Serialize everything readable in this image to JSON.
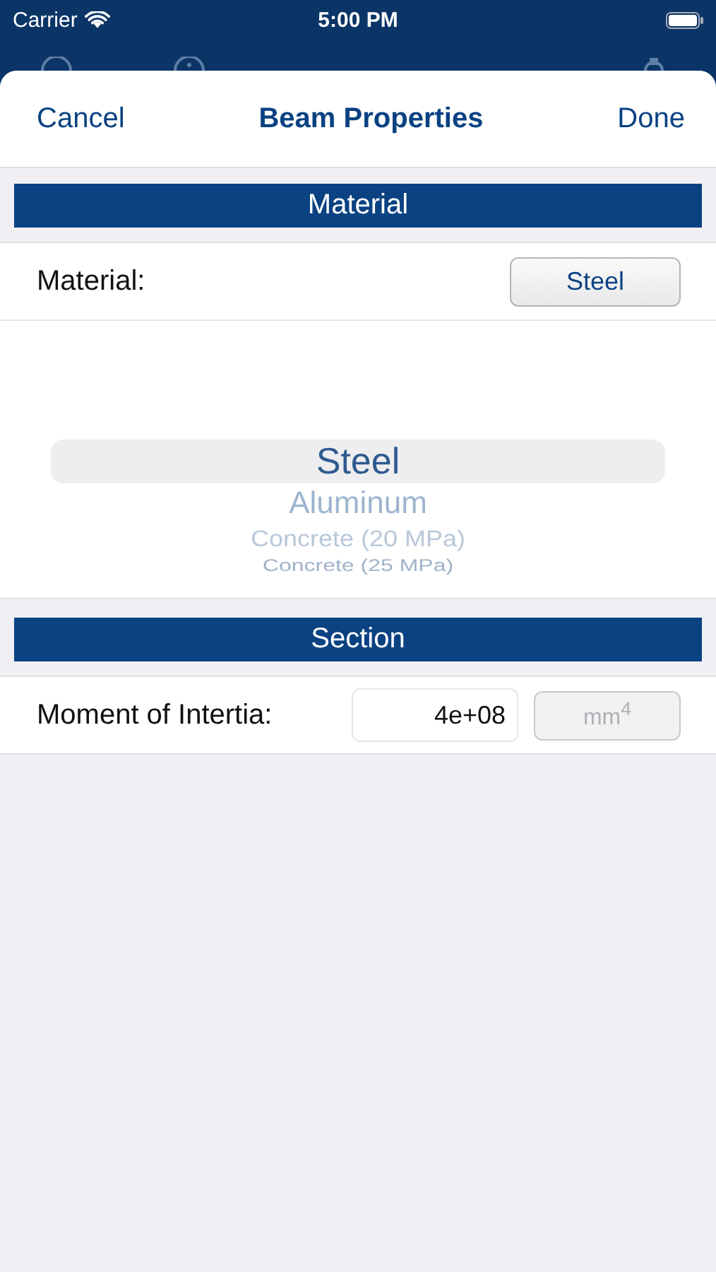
{
  "status_bar": {
    "carrier": "Carrier",
    "time": "5:00 PM"
  },
  "sheet": {
    "cancel": "Cancel",
    "title": "Beam Properties",
    "done": "Done"
  },
  "material_section": {
    "header": "Material",
    "label": "Material:",
    "button": "Steel",
    "picker": [
      {
        "label": "Steel",
        "selected": true
      },
      {
        "label": "Aluminum",
        "selected": false
      },
      {
        "label": "Concrete (20 MPa)",
        "selected": false
      },
      {
        "label": "Concrete (25 MPa)",
        "selected": false
      }
    ]
  },
  "section": {
    "header": "Section",
    "label": "Moment of Intertia:",
    "value": "4e+08",
    "unit": "mm$^{4}$",
    "unit_disabled": true
  }
}
